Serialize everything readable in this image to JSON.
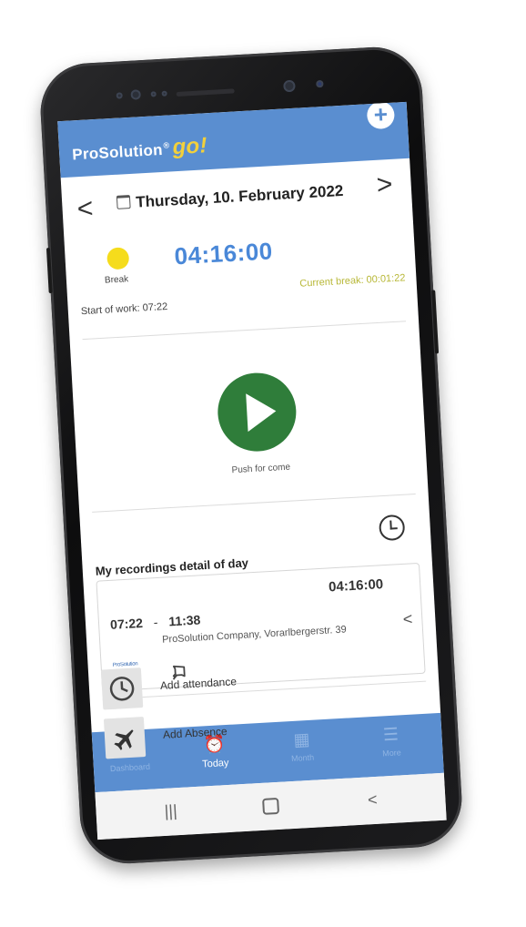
{
  "app": {
    "brand_name": "ProSolution",
    "brand_reg": "®",
    "brand_suffix": "go!",
    "add_label": "+"
  },
  "colors": {
    "appbar": "#5a8ed0",
    "accent_timer": "#4a88d8",
    "play_button": "#2f7d3a",
    "break_dot": "#f5dc1c",
    "brand_go": "#f2d03b"
  },
  "header": {
    "prev_arrow": "<",
    "next_arrow": ">",
    "date": "Thursday, 10. February 2022"
  },
  "status": {
    "state_label": "Break",
    "timer": "04:16:00",
    "current_break": "Current break: 00:01:22",
    "start_of_work": "Start of work: 07:22"
  },
  "punch": {
    "label": "Push for come"
  },
  "recordings": {
    "title": "My recordings detail of day",
    "items": [
      {
        "total": "04:16:00",
        "from": "07:22",
        "sep": "-",
        "to": "11:38",
        "location": "ProSolution Company, Vorarlbergerstr. 39",
        "chevron": "<",
        "logo_text": "ProSolution"
      }
    ]
  },
  "actions": [
    {
      "label": "Add attendance",
      "icon": "clock-icon"
    },
    {
      "label": "Add Absence",
      "icon": "airplane-icon"
    }
  ],
  "tabs": [
    {
      "label": "Dashboard",
      "icon": "home-icon",
      "glyph": "⌂",
      "active": false
    },
    {
      "label": "Today",
      "icon": "alarm-clock-icon",
      "glyph": "⏰",
      "active": true
    },
    {
      "label": "Month",
      "icon": "calendar-icon",
      "glyph": "▦",
      "active": false
    },
    {
      "label": "More",
      "icon": "menu-icon",
      "glyph": "☰",
      "active": false
    }
  ],
  "system_nav": {
    "recents": "|||",
    "back": "<"
  }
}
